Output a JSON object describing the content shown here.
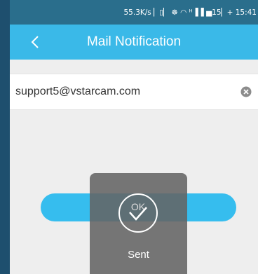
{
  "status_bar": {
    "text": "55.3K/s ▏▯▏ ☸ ◠ ᴴ▐▐ ▅15▏+ 15:41"
  },
  "header": {
    "title": "Mail Notification"
  },
  "email": {
    "value": "support5@vstarcam.com",
    "placeholder": ""
  },
  "send_button": {
    "label": ""
  },
  "toast": {
    "icon_text": "OK",
    "message": "Sent"
  },
  "colors": {
    "header": "#3ab9e8",
    "status_bar": "#2a6e8c",
    "button": "#36bdee",
    "toast": "#646464"
  }
}
